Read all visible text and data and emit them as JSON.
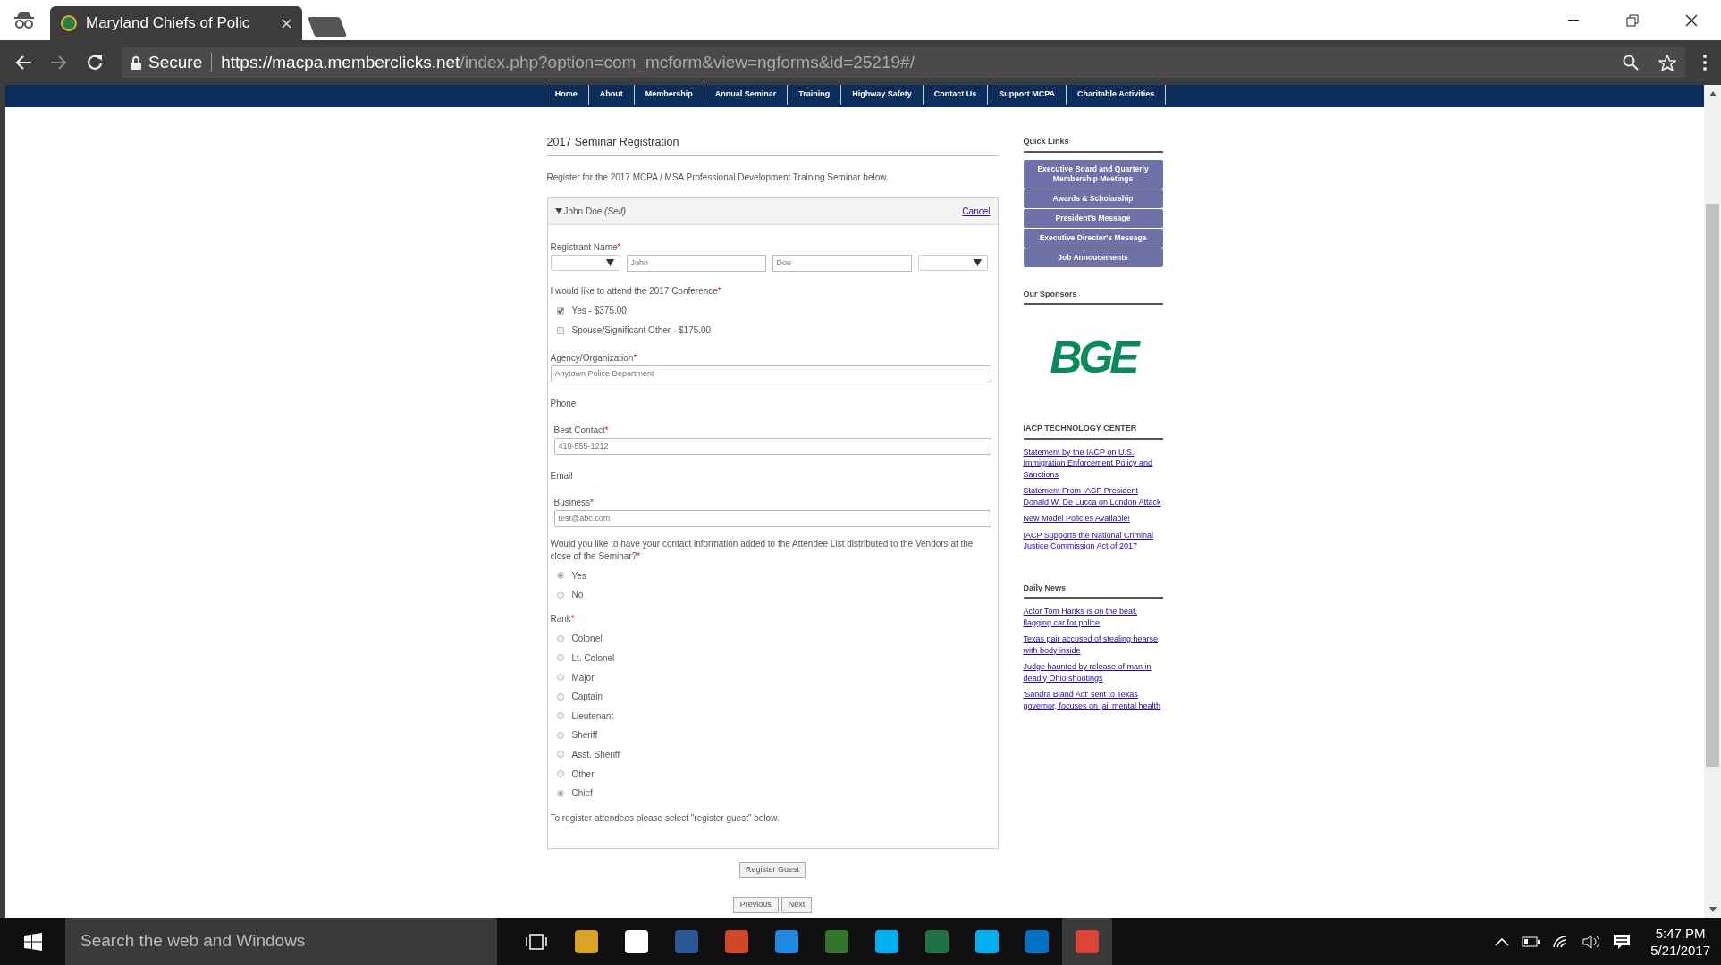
{
  "browser": {
    "tab_title": "Maryland Chiefs of Polic",
    "security": "Secure",
    "host": "https://macpa.memberclicks.net",
    "path": "/index.php?option=com_mcform&view=ngforms&id=25219#/"
  },
  "nav": [
    "Home",
    "About",
    "Membership",
    "Annual Seminar",
    "Training",
    "Highway Safety",
    "Contact Us",
    "Support MCPA",
    "Charitable Activities"
  ],
  "form": {
    "title": "2017 Seminar Registration",
    "intro": "Register for the 2017 MCPA / MSA Professional Development Training Seminar below.",
    "registrant": {
      "name": "John Doe *(Self)*",
      "expanded": true,
      "cancel": "Cancel"
    },
    "fields": [
      {
        "kind": "name_row",
        "label": "Registrant Name",
        "required_mark": "*",
        "inputs": [
          {
            "kind": "select"
          },
          {
            "kind": "text",
            "value": "John"
          },
          {
            "kind": "text",
            "value": "Doe"
          },
          {
            "kind": "select"
          }
        ]
      },
      {
        "kind": "checkboxes",
        "label": "I would like to attend the 2017 Conference",
        "required_mark": "*",
        "options": [
          {
            "label": "Yes - $375.00",
            "checked": true
          },
          {
            "label": "Spouse/Significant Other - $175.00",
            "checked": false
          }
        ]
      },
      {
        "kind": "text",
        "label": "Agency/Organization",
        "required_mark": "*",
        "value": "Anytown Police Department",
        "indent": false
      },
      {
        "kind": "heading",
        "label": "Phone"
      },
      {
        "kind": "text",
        "label": "Best Contact",
        "required_mark": "*",
        "value": "410-555-1212",
        "indent": true
      },
      {
        "kind": "heading",
        "label": "Email"
      },
      {
        "kind": "text",
        "label": "Business",
        "required_mark": "*",
        "value": "test@abc.com",
        "indent": true
      },
      {
        "kind": "radios",
        "label": "Would you like to have your contact information added to the Attendee List distributed to the Vendors at the close of the Seminar?",
        "required_mark": "*",
        "options": [
          {
            "label": "Yes",
            "selected": true
          },
          {
            "label": "No",
            "selected": false
          }
        ]
      },
      {
        "kind": "radios",
        "label": "Rank",
        "required_mark": "*",
        "options": [
          {
            "label": "Colonel",
            "selected": false
          },
          {
            "label": "Lt. Colonel",
            "selected": false
          },
          {
            "label": "Major",
            "selected": false
          },
          {
            "label": "Captain",
            "selected": false
          },
          {
            "label": "Lieutenant",
            "selected": false
          },
          {
            "label": "Sheriff",
            "selected": false
          },
          {
            "label": "Asst. Sheriff",
            "selected": false
          },
          {
            "label": "Other",
            "selected": false
          },
          {
            "label": "Chief",
            "selected": true
          }
        ]
      },
      {
        "kind": "note",
        "label": "To register attendees please select \"register guest\" below."
      }
    ],
    "register_button": "Register Guest",
    "previous_button": "Previous",
    "next_button": "Next"
  },
  "sidebar": {
    "quick_links_title": "Quick Links",
    "quick_links": [
      "Executive Board and Quarterly Membership Meetings",
      "Awards & Scholarship",
      "President's Message",
      "Executive Director's Message",
      "Job Annoucements"
    ],
    "sponsors_title": "Our Sponsors",
    "sponsor_logo": "BGE",
    "tech_title": "IACP TECHNOLOGY CENTER",
    "tech_links": [
      "Statement by the IACP on U.S. Immigration Enforcement Policy and Sanctions",
      "Statement From IACP President Donald W. De Lucca on London Attack",
      "New Model Policies Available!",
      "IACP Supports the National Criminal Justice Commission Act of 2017"
    ],
    "news_title": "Daily News",
    "news_links": [
      "Actor Tom Hanks is on the beat, flagging car for police",
      "Texas pair accused of stealing hearse with body inside",
      "Judge haunted by release of man in deadly Ohio shootings",
      "'Sandra Bland Act' sent to Texas governor, focuses on jail mental health"
    ]
  },
  "taskbar": {
    "search_placeholder": "Search the web and Windows",
    "apps": [
      {
        "color": "#d9a520"
      },
      {
        "color": "#ffffff"
      },
      {
        "color": "#2b5797"
      },
      {
        "color": "#d24726"
      },
      {
        "color": "#1e88e5"
      },
      {
        "color": "#31752f"
      },
      {
        "color": "#00aff0"
      },
      {
        "color": "#207245"
      },
      {
        "color": "#00aff0"
      },
      {
        "color": "#0072c6"
      },
      {
        "color": "#db4437"
      }
    ],
    "time": "5:47 PM",
    "date": "5/21/2017"
  }
}
